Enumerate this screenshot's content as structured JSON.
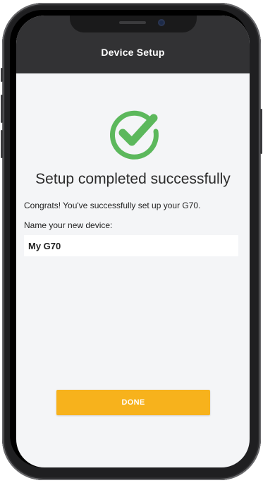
{
  "navbar": {
    "title": "Device Setup"
  },
  "status": {
    "icon": "checkmark-circle-icon",
    "color": "#5cb85c",
    "heading": "Setup completed successfully",
    "message": "Congrats! You've successfully set up your G70."
  },
  "form": {
    "name_label": "Name your new device:",
    "name_value": "My G70"
  },
  "actions": {
    "done_label": "DONE",
    "done_color": "#f7b21c"
  }
}
